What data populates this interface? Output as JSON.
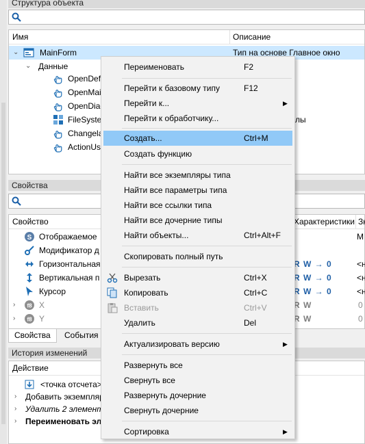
{
  "structure_panel": {
    "title": "Структура объекта",
    "columns": {
      "name": "Имя",
      "description": "Описание"
    },
    "root": {
      "name": "MainForm",
      "description": "Тип на основе Главное окно"
    },
    "group": "Данные",
    "items": [
      {
        "name": "OpenDefa",
        "desc": ""
      },
      {
        "name": "OpenMai",
        "desc": ""
      },
      {
        "name": "OpenDiag",
        "desc": ""
      },
      {
        "name": "FileSystem",
        "desc": "лы"
      },
      {
        "name": "Changela",
        "desc": ""
      },
      {
        "name": "ActionUs",
        "desc": ""
      }
    ]
  },
  "properties_panel": {
    "title": "Свойства",
    "columns": {
      "property": "Свойство",
      "characteristics": "Характеристики",
      "value": "Зн"
    },
    "rows": [
      {
        "name": "Отображаемое",
        "chars": "",
        "value": "М"
      },
      {
        "name": "Модификатор д",
        "chars": "",
        "value": ""
      },
      {
        "name": "Горизонтальная",
        "chars": "R W → 0",
        "value": "<н"
      },
      {
        "name": "Вертикальная п",
        "chars": "R W → 0",
        "value": "<н"
      },
      {
        "name": "Курсор",
        "chars": "R W → 0",
        "value": "<н"
      },
      {
        "name": "X",
        "chars": "R W",
        "value": "0"
      },
      {
        "name": "Y",
        "chars": "R W",
        "value": "0"
      }
    ],
    "tabs": [
      "Свойства",
      "События"
    ]
  },
  "history_panel": {
    "title": "История изменений",
    "column": "Действие",
    "rows": [
      {
        "text": "<точка отсчета>",
        "style": "normal"
      },
      {
        "text": "Добавить экземпляр",
        "style": "normal"
      },
      {
        "text": "Удалить 2 элемент",
        "style": "italic"
      },
      {
        "text": "Переименовать эл",
        "style": "bold"
      }
    ]
  },
  "context_menu": {
    "rename": {
      "label": "Переименовать",
      "shortcut": "F2"
    },
    "go_base": {
      "label": "Перейти к базовому типу",
      "shortcut": "F12"
    },
    "go_to": {
      "label": "Перейти к..."
    },
    "go_handler": {
      "label": "Перейти к обработчику..."
    },
    "create": {
      "label": "Создать...",
      "shortcut": "Ctrl+M"
    },
    "create_func": {
      "label": "Создать функцию"
    },
    "find_instances": {
      "label": "Найти все экземпляры типа"
    },
    "find_params": {
      "label": "Найти все параметры типа"
    },
    "find_refs": {
      "label": "Найти все ссылки типа"
    },
    "find_children": {
      "label": "Найти все дочерние типы"
    },
    "find_objects": {
      "label": "Найти объекты...",
      "shortcut": "Ctrl+Alt+F"
    },
    "copy_path": {
      "label": "Скопировать полный путь"
    },
    "cut": {
      "label": "Вырезать",
      "shortcut": "Ctrl+X"
    },
    "copy": {
      "label": "Копировать",
      "shortcut": "Ctrl+C"
    },
    "paste": {
      "label": "Вставить",
      "shortcut": "Ctrl+V"
    },
    "delete": {
      "label": "Удалить",
      "shortcut": "Del"
    },
    "update_version": {
      "label": "Актуализировать версию"
    },
    "expand_all": {
      "label": "Развернуть все"
    },
    "collapse_all": {
      "label": "Свернуть все"
    },
    "expand_children": {
      "label": "Развернуть дочерние"
    },
    "collapse_children": {
      "label": "Свернуть дочерние"
    },
    "sort": {
      "label": "Сортировка"
    }
  },
  "colors": {
    "selection": "#cce8ff",
    "menu_highlight": "#91c9f7",
    "icon_blue": "#1f6fb5"
  }
}
